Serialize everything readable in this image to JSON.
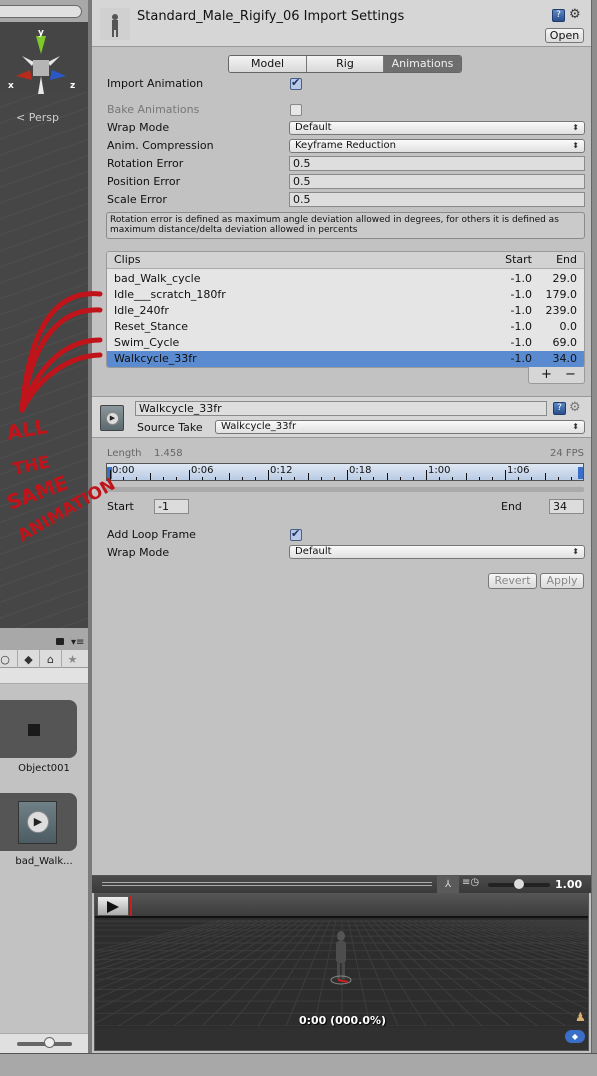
{
  "scene_view": {
    "axis_labels": {
      "x": "x",
      "y": "y",
      "z": "z"
    },
    "projection_label": "< Persp"
  },
  "annotation": {
    "text_lines": [
      "ALL",
      "THE",
      "SAME",
      "ANIMATION"
    ],
    "color": "#c0141a"
  },
  "project_panel": {
    "menu_glyph": "▾≡",
    "toolbar_icons": [
      "search-icon",
      "shapes-icon",
      "tag-icon",
      "star-icon"
    ],
    "assets": [
      {
        "label": "Object001",
        "icon": "mesh-cube-icon"
      },
      {
        "label": "bad_Walk...",
        "icon": "animation-clip-icon"
      }
    ]
  },
  "inspector": {
    "title": "Standard_Male_Rigify_06 Import Settings",
    "open_label": "Open",
    "help_glyph": "?",
    "tabs": [
      {
        "label": "Model",
        "active": false
      },
      {
        "label": "Rig",
        "active": false
      },
      {
        "label": "Animations",
        "active": true
      }
    ],
    "import_animation": {
      "label": "Import Animation",
      "checked": true
    },
    "bake_animations": {
      "label": "Bake Animations",
      "checked": false,
      "disabled": true
    },
    "wrap_mode": {
      "label": "Wrap Mode",
      "value": "Default"
    },
    "anim_compression": {
      "label": "Anim. Compression",
      "value": "Keyframe Reduction"
    },
    "rotation_error": {
      "label": "Rotation Error",
      "value": "0.5"
    },
    "position_error": {
      "label": "Position Error",
      "value": "0.5"
    },
    "scale_error": {
      "label": "Scale Error",
      "value": "0.5"
    },
    "help_text": "Rotation error is defined as maximum angle deviation allowed in degrees, for others it is defined as maximum distance/delta deviation allowed in percents",
    "clips": {
      "headers": {
        "name": "Clips",
        "start": "Start",
        "end": "End"
      },
      "rows": [
        {
          "name": "bad_Walk_cycle",
          "start": "-1.0",
          "end": "29.0",
          "selected": false
        },
        {
          "name": "Idle___scratch_180fr",
          "start": "-1.0",
          "end": "179.0",
          "selected": false
        },
        {
          "name": "Idle_240fr",
          "start": "-1.0",
          "end": "239.0",
          "selected": false
        },
        {
          "name": "Reset_Stance",
          "start": "-1.0",
          "end": "0.0",
          "selected": false
        },
        {
          "name": "Swim_Cycle",
          "start": "-1.0",
          "end": "69.0",
          "selected": false
        },
        {
          "name": "Walkcycle_33fr",
          "start": "-1.0",
          "end": "34.0",
          "selected": true
        }
      ],
      "add_label": "+",
      "remove_label": "−"
    },
    "clip": {
      "name": "Walkcycle_33fr",
      "source_take_label": "Source Take",
      "source_take_value": "Walkcycle_33fr",
      "length_label": "Length",
      "length_value": "1.458",
      "fps": "24 FPS",
      "timeline_labels": [
        "0:00",
        "0:06",
        "0:12",
        "0:18",
        "1:00",
        "1:06"
      ],
      "start_label": "Start",
      "start_value": "-1",
      "end_label": "End",
      "end_value": "34",
      "add_loop_frame": {
        "label": "Add Loop Frame",
        "checked": true
      },
      "wrap_mode": {
        "label": "Wrap Mode",
        "value": "Default"
      },
      "revert_label": "Revert",
      "apply_label": "Apply"
    },
    "preview": {
      "speed_value": "1.00",
      "speed_fraction": 0.5,
      "time_readout": "0:00 (000.0%)"
    }
  },
  "colors": {
    "selection": "#5a8bd0",
    "active_tab": "#6e6e6e",
    "panel_bg": "#c2c2c2"
  }
}
